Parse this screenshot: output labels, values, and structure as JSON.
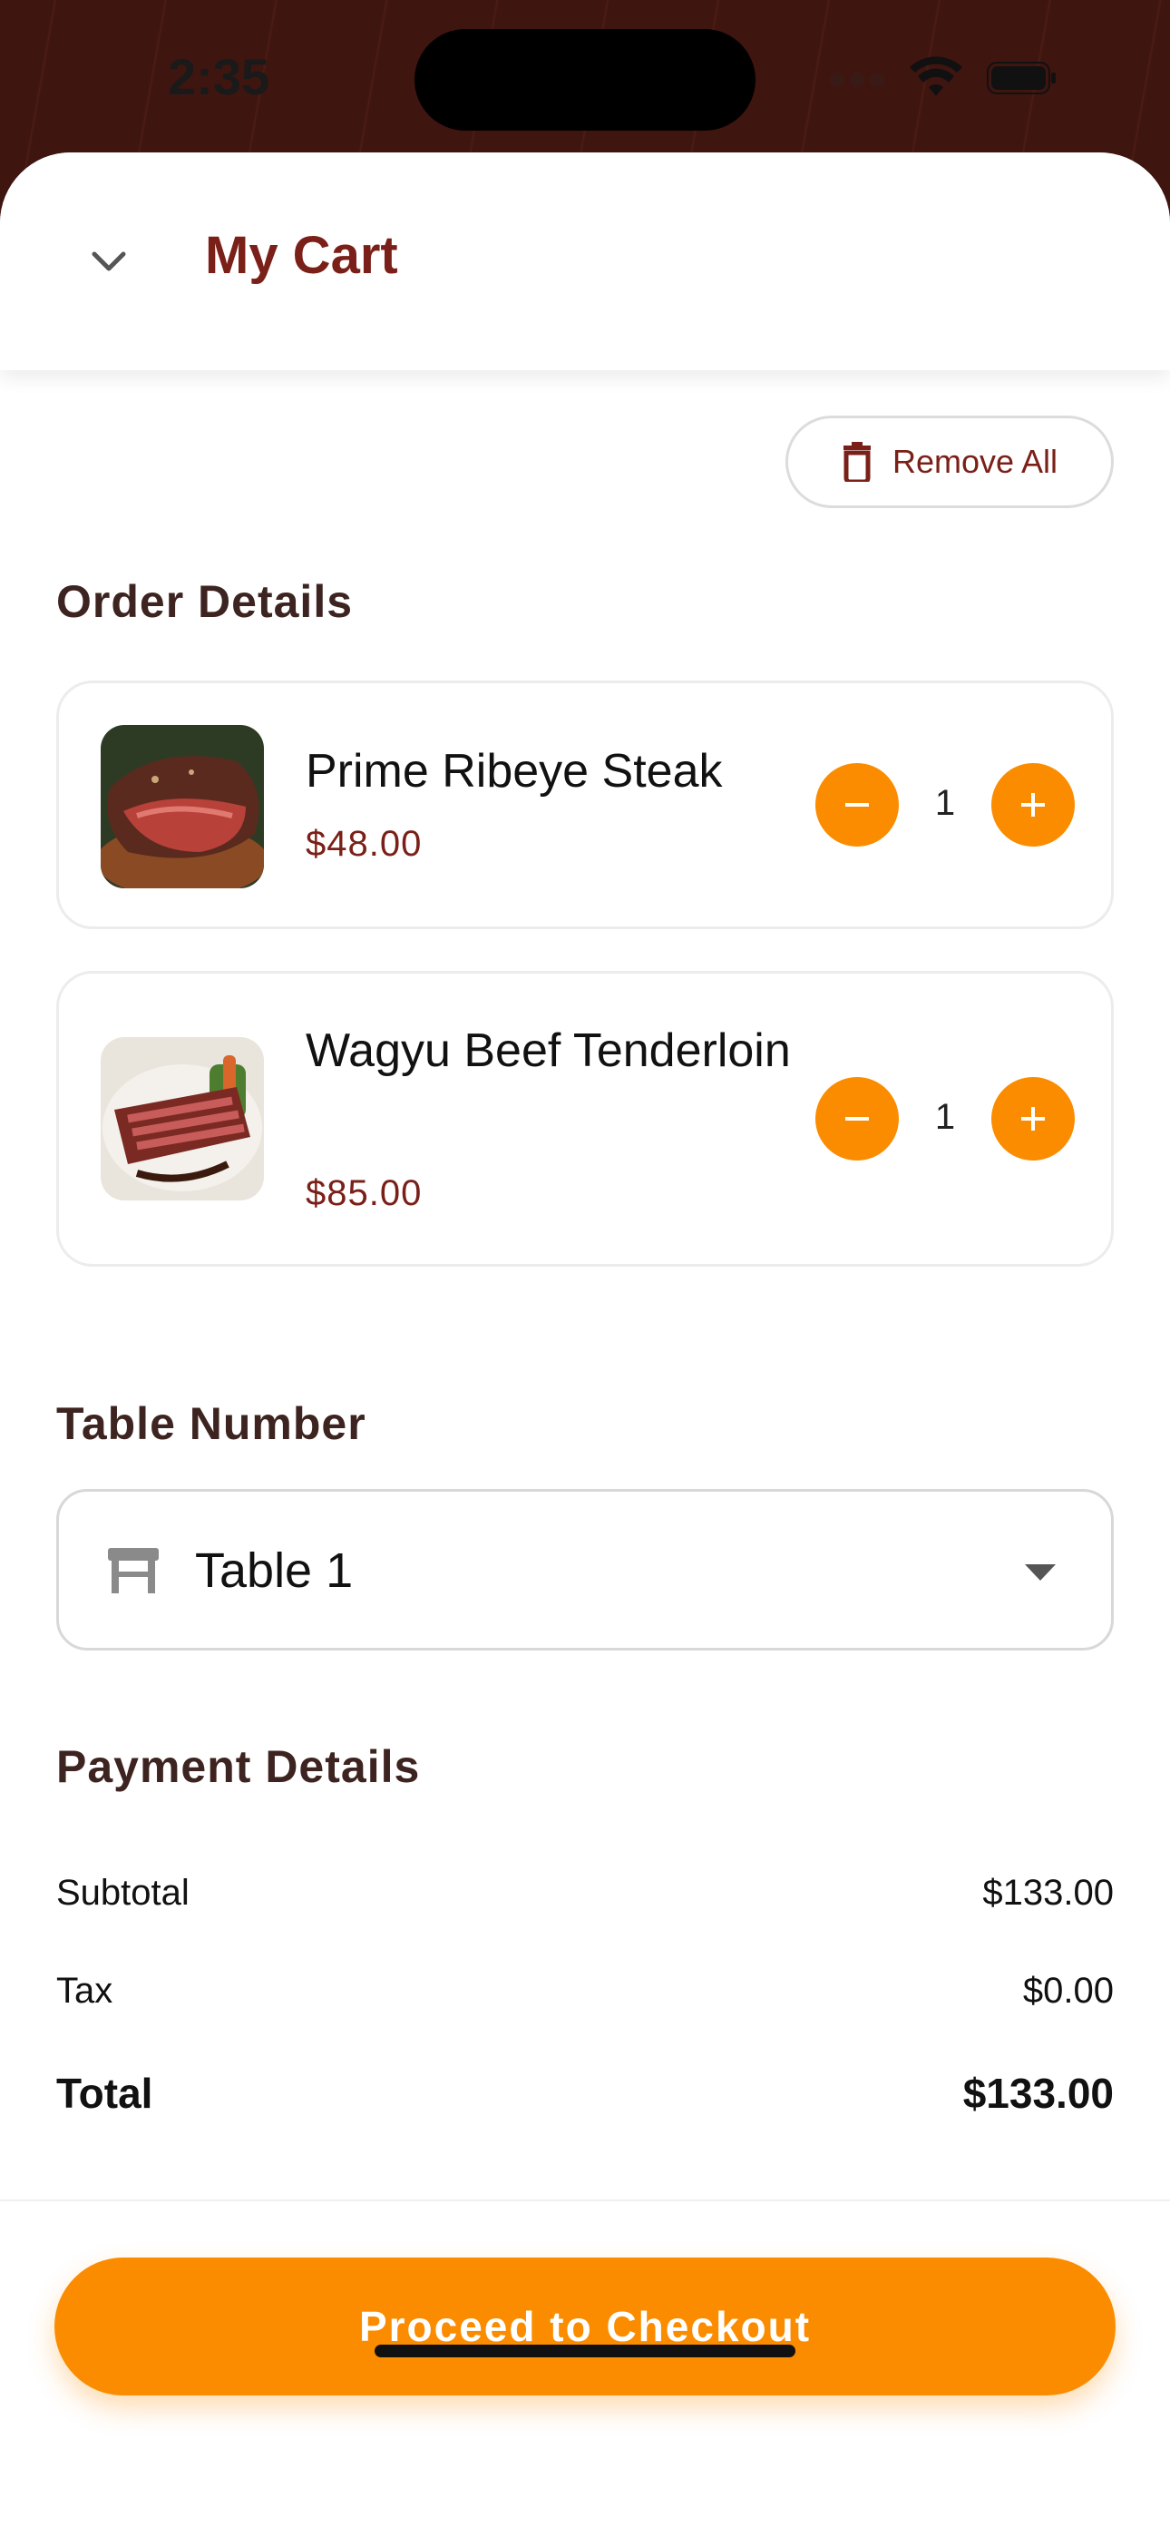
{
  "status_bar": {
    "time": "2:35"
  },
  "header": {
    "title": "My Cart"
  },
  "actions": {
    "remove_all_label": "Remove All"
  },
  "order_details": {
    "title": "Order Details",
    "items": [
      {
        "name": "Prime Ribeye Steak",
        "price": "$48.00",
        "quantity": "1"
      },
      {
        "name": "Wagyu Beef Tenderloin",
        "price": "$85.00",
        "quantity": "1"
      }
    ]
  },
  "table": {
    "title": "Table Number",
    "selected": "Table 1"
  },
  "payment": {
    "title": "Payment Details",
    "subtotal_label": "Subtotal",
    "subtotal_value": "$133.00",
    "tax_label": "Tax",
    "tax_value": "$0.00",
    "total_label": "Total",
    "total_value": "$133.00"
  },
  "checkout": {
    "button_label": "Proceed to Checkout"
  },
  "colors": {
    "accent": "#fb8c00",
    "brand": "#7a2018",
    "header_bg": "#4a1a14"
  },
  "icons": [
    "chevron-down-icon",
    "trash-icon",
    "minus-icon",
    "plus-icon",
    "table-icon",
    "dropdown-arrow-icon",
    "wifi-icon",
    "battery-icon"
  ]
}
